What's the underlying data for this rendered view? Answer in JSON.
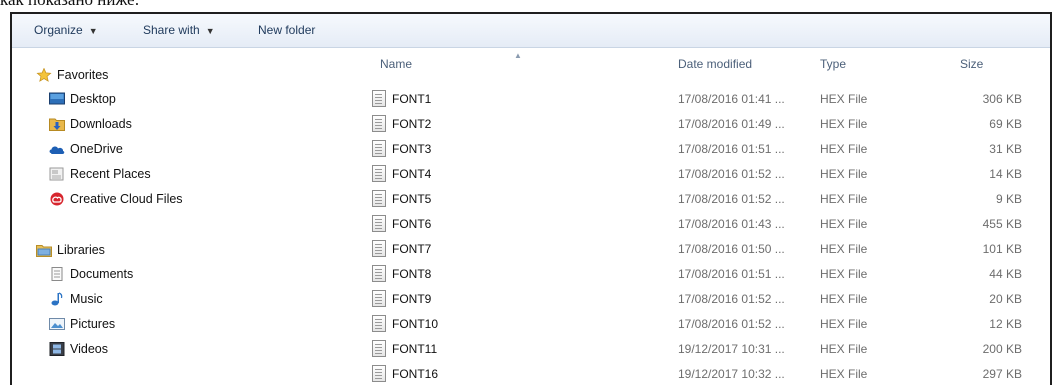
{
  "caption": "как показано ниже:",
  "toolbar": {
    "organize": "Organize",
    "share_with": "Share with",
    "new_folder": "New folder"
  },
  "nav": {
    "favorites": {
      "label": "Favorites",
      "items": [
        {
          "label": "Desktop",
          "icon": "desktop-icon"
        },
        {
          "label": "Downloads",
          "icon": "downloads-icon"
        },
        {
          "label": "OneDrive",
          "icon": "onedrive-icon"
        },
        {
          "label": "Recent Places",
          "icon": "recent-places-icon"
        },
        {
          "label": "Creative Cloud Files",
          "icon": "creative-cloud-icon"
        }
      ]
    },
    "libraries": {
      "label": "Libraries",
      "items": [
        {
          "label": "Documents",
          "icon": "documents-icon"
        },
        {
          "label": "Music",
          "icon": "music-icon"
        },
        {
          "label": "Pictures",
          "icon": "pictures-icon"
        },
        {
          "label": "Videos",
          "icon": "videos-icon"
        }
      ]
    }
  },
  "columns": {
    "name": "Name",
    "date": "Date modified",
    "type": "Type",
    "size": "Size"
  },
  "files": [
    {
      "name": "FONT1",
      "date": "17/08/2016 01:41 ...",
      "type": "HEX File",
      "size": "306 KB"
    },
    {
      "name": "FONT2",
      "date": "17/08/2016 01:49 ...",
      "type": "HEX File",
      "size": "69 KB"
    },
    {
      "name": "FONT3",
      "date": "17/08/2016 01:51 ...",
      "type": "HEX File",
      "size": "31 KB"
    },
    {
      "name": "FONT4",
      "date": "17/08/2016 01:52 ...",
      "type": "HEX File",
      "size": "14 KB"
    },
    {
      "name": "FONT5",
      "date": "17/08/2016 01:52 ...",
      "type": "HEX File",
      "size": "9 KB"
    },
    {
      "name": "FONT6",
      "date": "17/08/2016 01:43 ...",
      "type": "HEX File",
      "size": "455 KB"
    },
    {
      "name": "FONT7",
      "date": "17/08/2016 01:50 ...",
      "type": "HEX File",
      "size": "101 KB"
    },
    {
      "name": "FONT8",
      "date": "17/08/2016 01:51 ...",
      "type": "HEX File",
      "size": "44 KB"
    },
    {
      "name": "FONT9",
      "date": "17/08/2016 01:52 ...",
      "type": "HEX File",
      "size": "20 KB"
    },
    {
      "name": "FONT10",
      "date": "17/08/2016 01:52 ...",
      "type": "HEX File",
      "size": "12 KB"
    },
    {
      "name": "FONT11",
      "date": "19/12/2017 10:31 ...",
      "type": "HEX File",
      "size": "200 KB"
    },
    {
      "name": "FONT16",
      "date": "19/12/2017 10:32 ...",
      "type": "HEX File",
      "size": "297 KB"
    }
  ],
  "colors": {
    "toolbar_text": "#1e395b",
    "header_text": "#4c607a",
    "detail_text": "#6d6d6d"
  }
}
